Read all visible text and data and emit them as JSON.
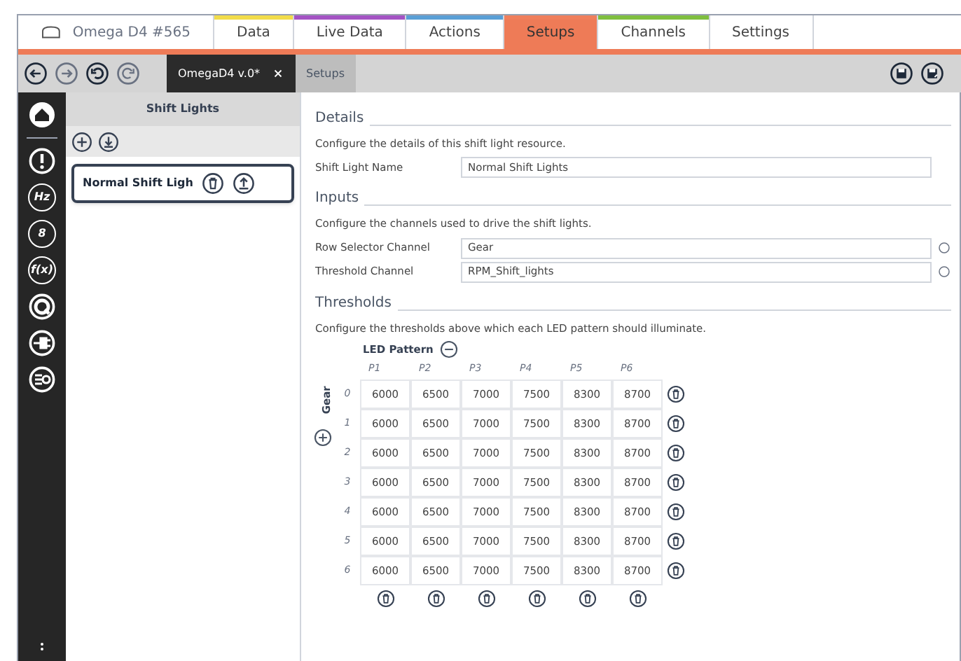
{
  "tabs": [
    {
      "label": "Omega D4 #565",
      "kind": "device",
      "selected": false
    },
    {
      "label": "Data",
      "kind": "page",
      "selected": false,
      "color": "#f2dc4a"
    },
    {
      "label": "Live Data",
      "kind": "page",
      "selected": false,
      "color": "#a453c4"
    },
    {
      "label": "Actions",
      "kind": "page",
      "selected": false,
      "color": "#5a9fd6"
    },
    {
      "label": "Setups",
      "kind": "page",
      "selected": true,
      "color": "#f07f5c"
    },
    {
      "label": "Channels",
      "kind": "page",
      "selected": false,
      "color": "#7fbf3f"
    },
    {
      "label": "Settings",
      "kind": "page",
      "selected": false
    }
  ],
  "doc_tabs": [
    {
      "label": "OmegaD4 v.0*",
      "selected": true,
      "closable": true
    },
    {
      "label": "Setups",
      "selected": false,
      "closable": false
    }
  ],
  "sidebar": {
    "items": [
      {
        "kind": "home"
      },
      {
        "kind": "alert"
      },
      {
        "kind": "glyph",
        "label": "Hz"
      },
      {
        "kind": "glyph",
        "label": "8"
      },
      {
        "kind": "glyph",
        "label": "f(x)"
      },
      {
        "kind": "gauge"
      },
      {
        "kind": "plug"
      },
      {
        "kind": "list"
      }
    ]
  },
  "panel": {
    "title": "Shift Lights",
    "items": [
      {
        "label": "Normal Shift Ligh",
        "selected": true
      }
    ]
  },
  "details": {
    "heading": "Details",
    "description": "Configure the details of this shift light resource.",
    "fields": [
      {
        "label": "Shift Light Name",
        "value": "Normal Shift Lights",
        "picker": false
      }
    ]
  },
  "inputs": {
    "heading": "Inputs",
    "description": "Configure the channels used to drive the shift lights.",
    "fields": [
      {
        "label": "Row Selector Channel",
        "value": "Gear",
        "picker": true
      },
      {
        "label": "Threshold Channel",
        "value": "RPM_Shift_lights",
        "picker": true
      }
    ]
  },
  "thresholds": {
    "heading": "Thresholds",
    "description": "Configure the thresholds above which each LED pattern should illuminate.",
    "column_axis": "LED Pattern",
    "row_axis": "Gear",
    "columns": [
      "P1",
      "P2",
      "P3",
      "P4",
      "P5",
      "P6"
    ],
    "rows": [
      {
        "label": "0",
        "values": [
          "6000",
          "6500",
          "7000",
          "7500",
          "8300",
          "8700"
        ]
      },
      {
        "label": "1",
        "values": [
          "6000",
          "6500",
          "7000",
          "7500",
          "8300",
          "8700"
        ]
      },
      {
        "label": "2",
        "values": [
          "6000",
          "6500",
          "7000",
          "7500",
          "8300",
          "8700"
        ]
      },
      {
        "label": "3",
        "values": [
          "6000",
          "6500",
          "7000",
          "7500",
          "8300",
          "8700"
        ]
      },
      {
        "label": "4",
        "values": [
          "6000",
          "6500",
          "7000",
          "7500",
          "8300",
          "8700"
        ]
      },
      {
        "label": "5",
        "values": [
          "6000",
          "6500",
          "7000",
          "7500",
          "8300",
          "8700"
        ]
      },
      {
        "label": "6",
        "values": [
          "6000",
          "6500",
          "7000",
          "7500",
          "8300",
          "8700"
        ]
      }
    ]
  }
}
